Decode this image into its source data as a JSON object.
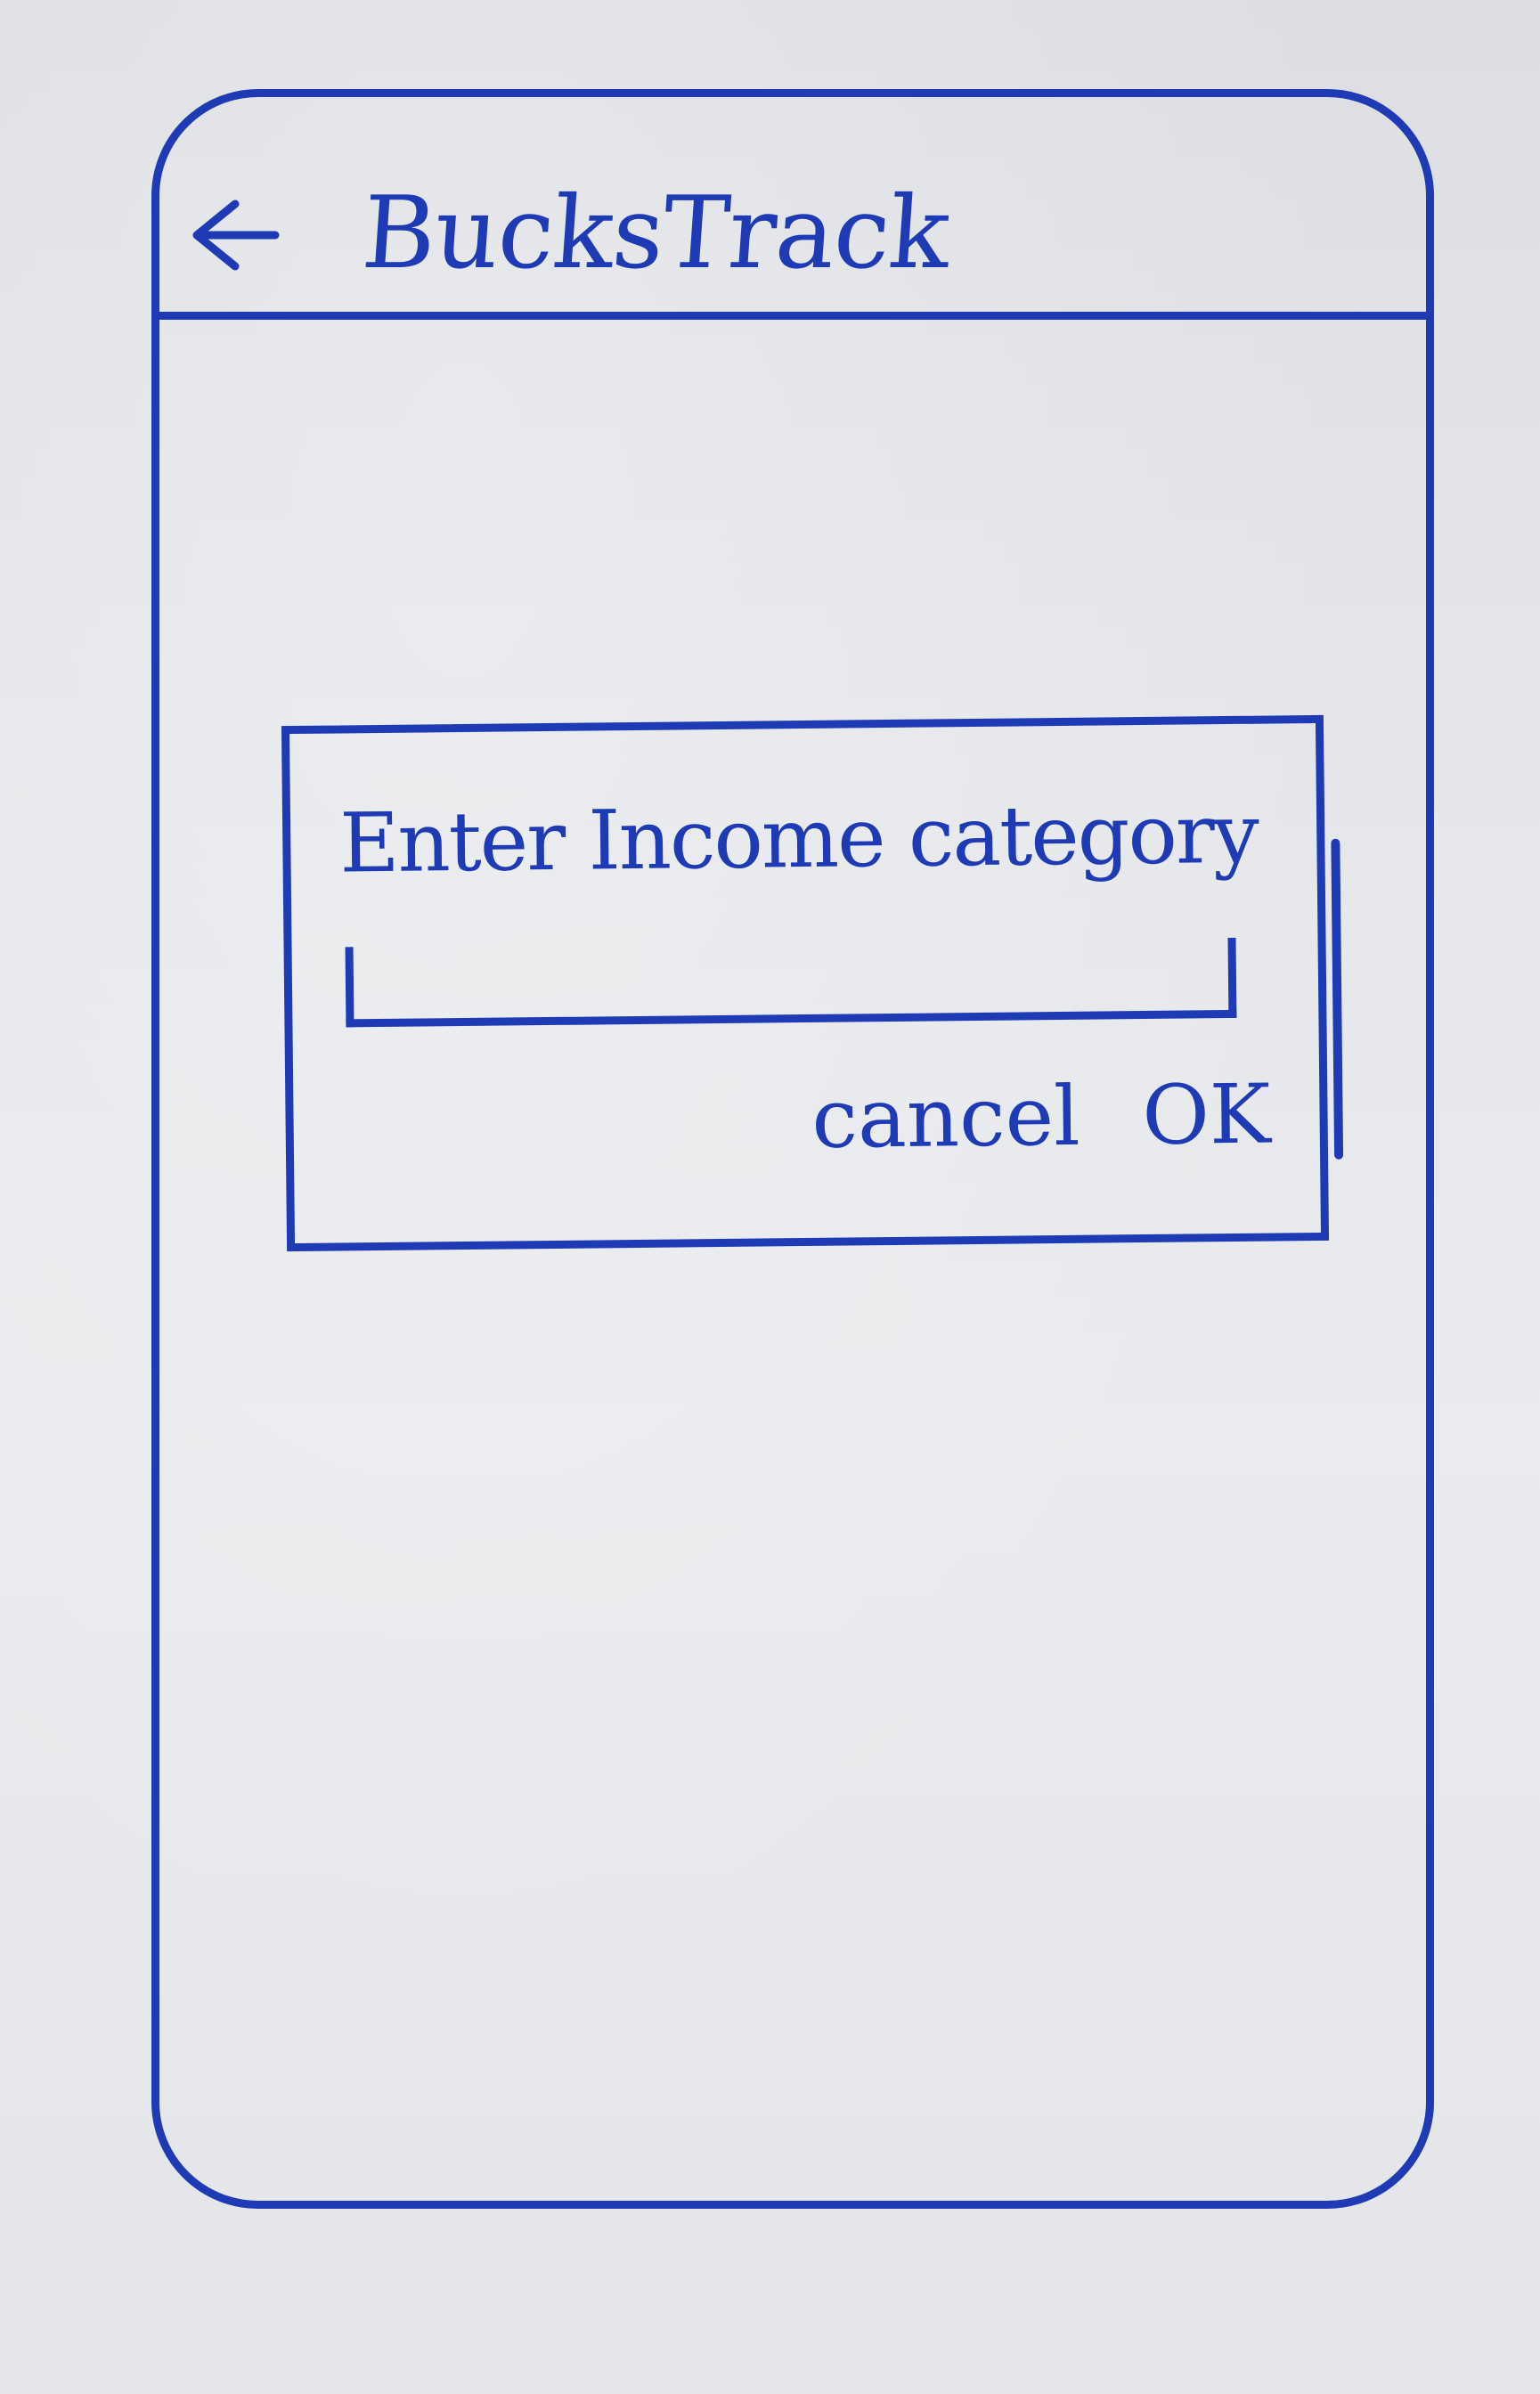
{
  "app_bar": {
    "title": "BucksTrack",
    "back_icon": "arrow-left-icon"
  },
  "dialog": {
    "title": "Enter Income category",
    "input_value": "",
    "cancel_label": "cancel",
    "ok_label": "OK"
  },
  "colors": {
    "ink": "#1e3ab4",
    "paper": "#e4e6ea"
  }
}
